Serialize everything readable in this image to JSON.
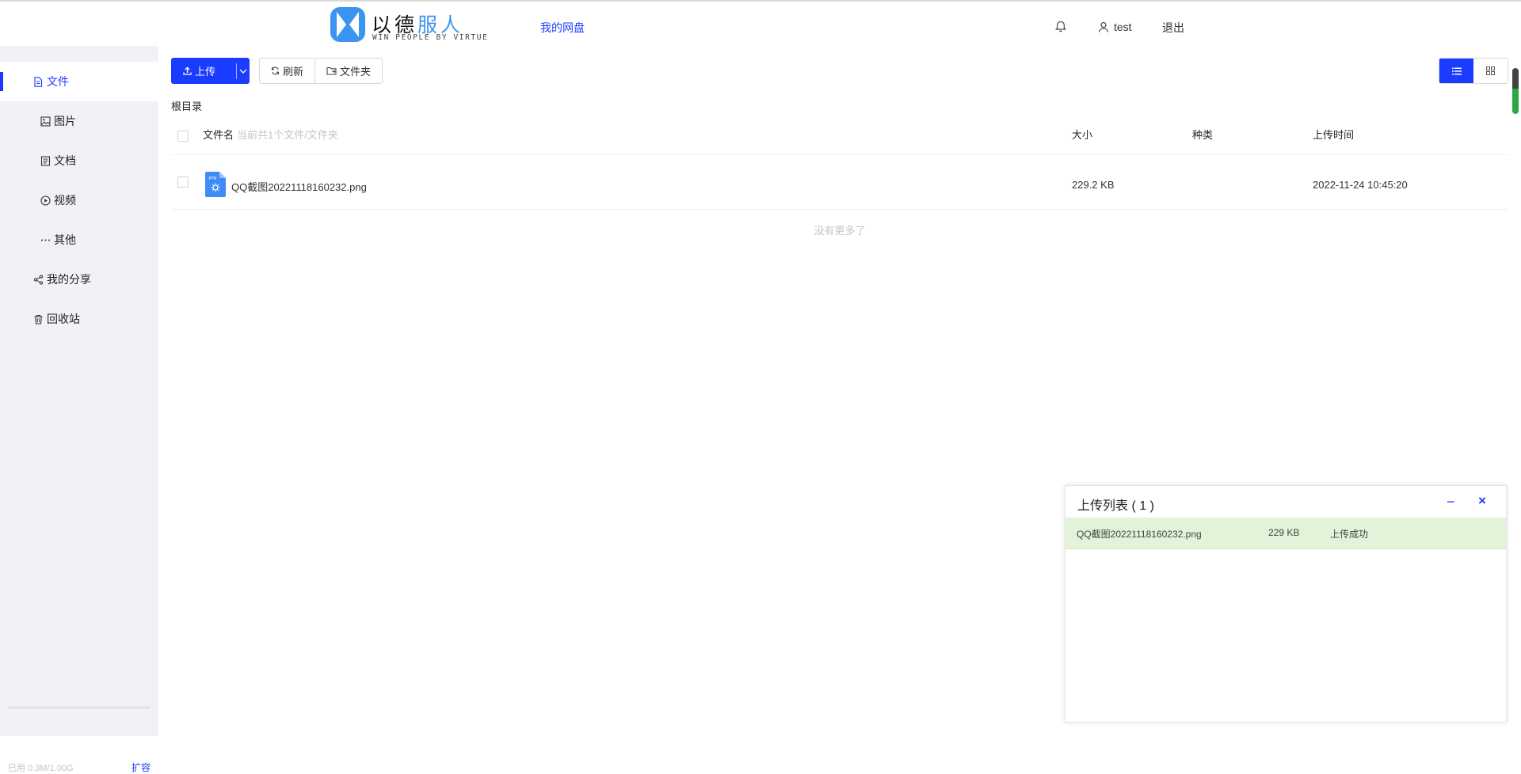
{
  "header": {
    "logo_cn": "以德",
    "logo_cn_blue": "服人",
    "logo_en": "WIN PEOPLE BY VIRTUE",
    "nav_disk": "我的网盘",
    "username": "test",
    "logout": "退出"
  },
  "sidebar": {
    "items": [
      {
        "label": "文件",
        "icon": "file-icon"
      },
      {
        "label": "图片",
        "icon": "image-icon"
      },
      {
        "label": "文档",
        "icon": "document-icon"
      },
      {
        "label": "视频",
        "icon": "video-icon"
      },
      {
        "label": "其他",
        "icon": "more-icon"
      },
      {
        "label": "我的分享",
        "icon": "share-icon"
      },
      {
        "label": "回收站",
        "icon": "trash-icon"
      }
    ],
    "usage_text": "已用 0.3M/1.00G",
    "usage_fraction": 0.0003,
    "expand": "扩容"
  },
  "toolbar": {
    "upload": "上传",
    "refresh": "刷新",
    "folder": "文件夹"
  },
  "breadcrumb": "根目录",
  "table": {
    "col_name": "文件名",
    "col_hint": "当前共1个文件/文件夹",
    "col_size": "大小",
    "col_type": "种类",
    "col_time": "上传时间",
    "rows": [
      {
        "name": "QQ截图20221118160232.png",
        "size": "229.2 KB",
        "type": "",
        "time": "2022-11-24 10:45:20",
        "ext": ".png"
      }
    ],
    "no_more": "没有更多了"
  },
  "upload_panel": {
    "title": "上传列表 ( 1 )",
    "minimize": "−",
    "close": "×",
    "items": [
      {
        "name": "QQ截图20221118160232.png",
        "size": "229 KB",
        "status": "上传成功"
      }
    ]
  },
  "colors": {
    "accent": "#1b3bff",
    "logo_blue": "#3b95f0",
    "success_bg": "#e1f3d8"
  }
}
